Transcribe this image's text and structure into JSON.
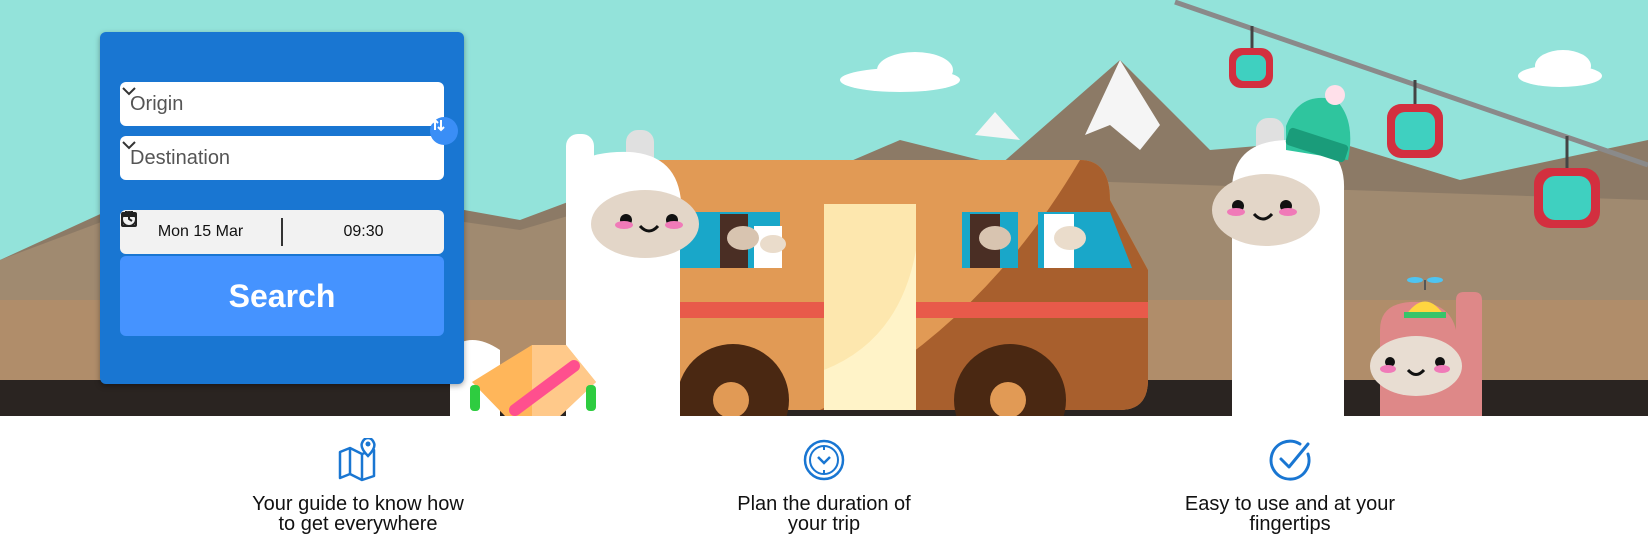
{
  "search_form": {
    "origin_placeholder": "Origin",
    "destination_placeholder": "Destination",
    "date": "Mon 15 Mar",
    "time": "09:30",
    "search_label": "Search"
  },
  "features": [
    {
      "icon": "map-pin-icon",
      "line1": "Your guide to know how",
      "line2": "to get everywhere"
    },
    {
      "icon": "clock-icon",
      "line1": "Plan the duration of",
      "line2": "your trip"
    },
    {
      "icon": "check-circle-icon",
      "line1": "Easy to use and at your",
      "line2": "fingertips"
    }
  ],
  "colors": {
    "sky": "#93e3da",
    "panel": "#1976d2",
    "search_button": "#4593ff",
    "bus": "#e19a55",
    "icon_blue": "#1976d2"
  }
}
